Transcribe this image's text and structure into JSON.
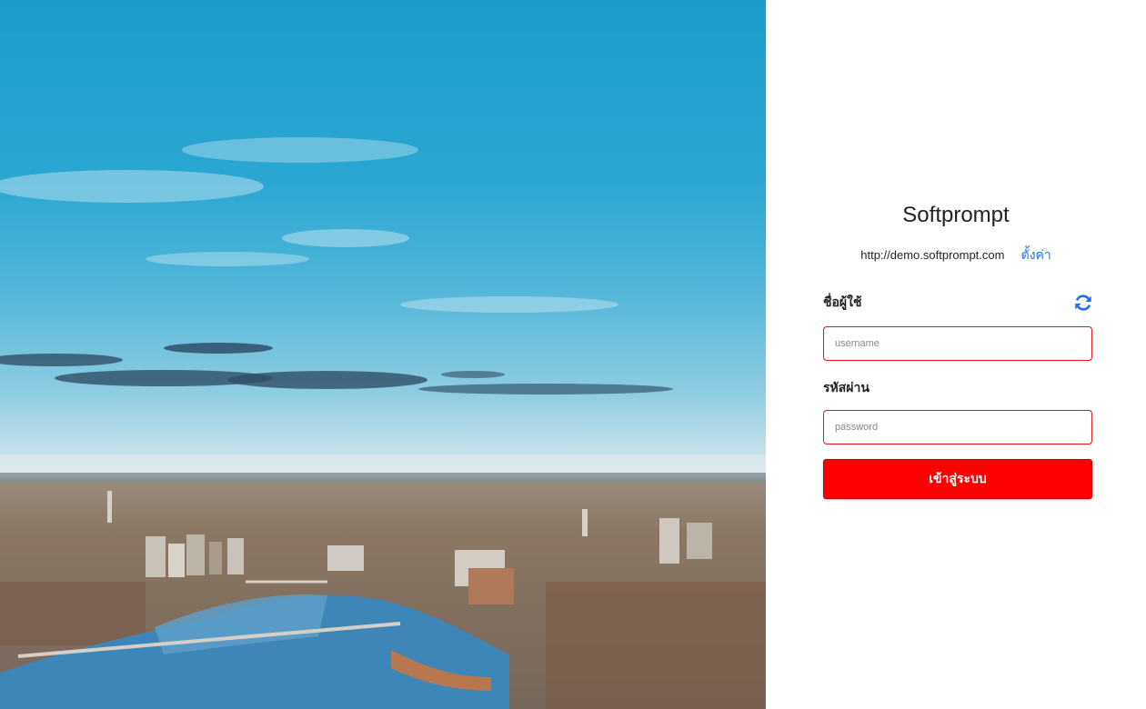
{
  "brand": {
    "title": "Softprompt"
  },
  "server": {
    "url": "http://demo.softprompt.com",
    "settings_label": "ตั้งค่า"
  },
  "form": {
    "username_label": "ชื่อผู้ใช้",
    "username_placeholder": "username",
    "username_value": "",
    "password_label": "รหัสผ่าน",
    "password_placeholder": "password",
    "password_value": "",
    "submit_label": "เข้าสู่ระบบ"
  },
  "icons": {
    "refresh": "refresh-icon"
  },
  "colors": {
    "accent_red": "#ff0000",
    "field_border": "#e4141b",
    "link_blue": "#1e73e8",
    "text_dark": "#222222"
  }
}
